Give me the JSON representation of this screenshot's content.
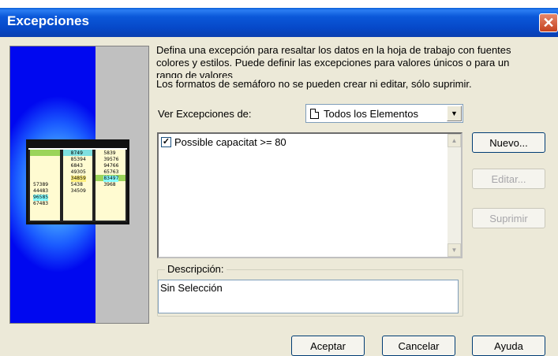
{
  "window": {
    "title": "Excepciones"
  },
  "info_lines": [
    "Defina una excepción para resaltar los datos en la hoja de trabajo con fuentes",
    "colores y estilos. Puede definir las excepciones para valores únicos o para un",
    "rango de valores",
    "Los formatos de semáforo no se pueden crear ni editar, sólo suprimir."
  ],
  "ver": {
    "label": "Ver Excepciones de:",
    "selected": "Todos los Elementos"
  },
  "list": [
    {
      "checked": true,
      "text": "Possible capacitat  >= 80"
    }
  ],
  "buttons": {
    "nuevo": "Nuevo...",
    "editar": "Editar...",
    "suprimir": "Suprimir",
    "aceptar": "Aceptar",
    "cancelar": "Cancelar",
    "ayuda": "Ayuda"
  },
  "descripcion": {
    "label": "Descripción:",
    "value": "Sin Selección"
  },
  "preview_values": {
    "col1": [
      "57389",
      "44483",
      "96585",
      "67483"
    ],
    "col2": [
      "8749",
      "85394",
      "6843",
      "49305",
      "34859",
      "5438",
      "34509"
    ],
    "col3": [
      "5839",
      "39576",
      "94766",
      "65763",
      "83497",
      "3968"
    ]
  }
}
